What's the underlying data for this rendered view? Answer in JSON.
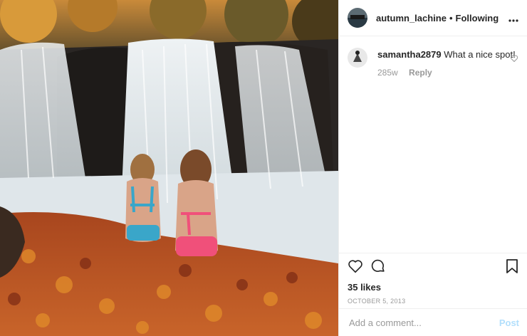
{
  "photo": {
    "icon": "waterfall-photo"
  },
  "header": {
    "username": "autumn_lachine",
    "separator": "•",
    "follow_label": "Following",
    "more_icon": "more-horizontal-icon"
  },
  "comments": [
    {
      "username": "samantha2879",
      "text": "What a nice spot!",
      "age": "285w",
      "reply_label": "Reply"
    }
  ],
  "actions": {
    "likes": "35 likes",
    "date": "OCTOBER 5, 2013"
  },
  "add_comment": {
    "placeholder": "Add a comment...",
    "post_label": "Post"
  },
  "colors": {
    "link_disabled": "#b2dffc",
    "muted": "#999999",
    "text": "#262626"
  }
}
